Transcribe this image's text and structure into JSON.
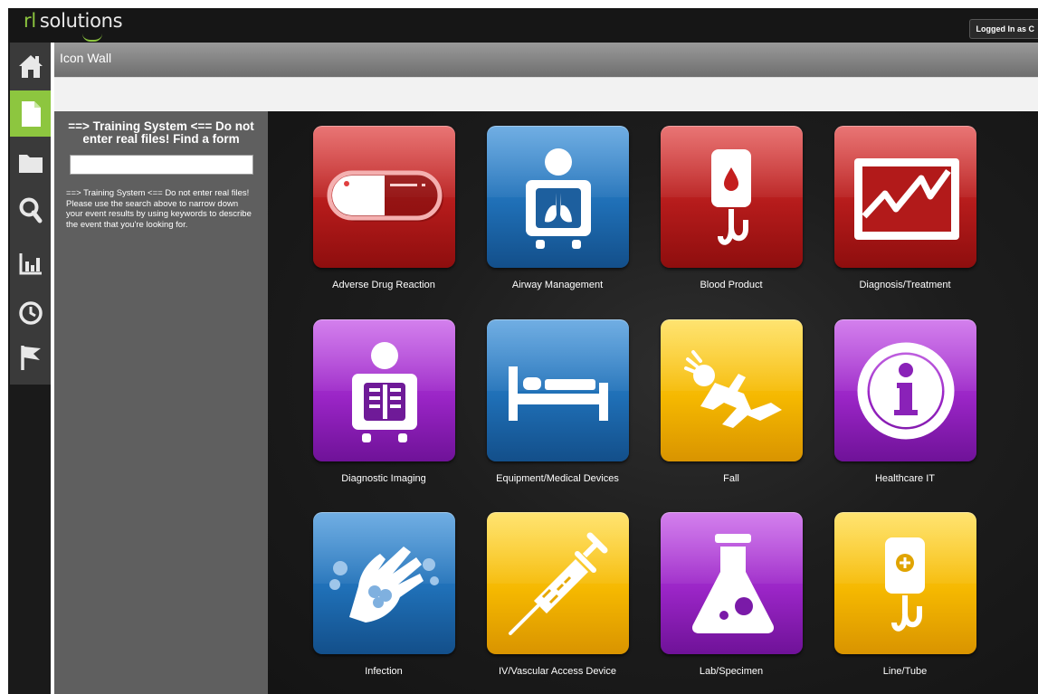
{
  "brand": {
    "prefix": "rl",
    "name": "solutions",
    "accent": "#8dc63f"
  },
  "header": {
    "logged_in": "Logged In as C"
  },
  "nav": {
    "items": [
      {
        "icon": "home-icon",
        "active": false
      },
      {
        "icon": "document-icon",
        "active": true
      },
      {
        "icon": "folder-icon",
        "active": false
      },
      {
        "icon": "search-icon",
        "active": false
      },
      {
        "icon": "bar-chart-icon",
        "active": false
      },
      {
        "icon": "clock-icon",
        "active": false
      },
      {
        "icon": "flag-icon",
        "active": false
      }
    ]
  },
  "page": {
    "title": "Icon Wall"
  },
  "sidebar": {
    "heading": "==> Training System <== Do not enter real files! Find a form",
    "search_value": "",
    "help_text": "==> Training System <== Do not enter real files! Please use the search above to narrow down your event results by using keywords to describe the event that you're looking for."
  },
  "tiles": [
    {
      "label": "Adverse Drug Reaction",
      "color": "red",
      "icon": "pill-icon"
    },
    {
      "label": "Airway Management",
      "color": "blue",
      "icon": "lungs-xray-icon"
    },
    {
      "label": "Blood Product",
      "color": "red",
      "icon": "blood-bag-icon"
    },
    {
      "label": "Diagnosis/Treatment",
      "color": "red",
      "icon": "vital-monitor-icon"
    },
    {
      "label": "Diagnostic Imaging",
      "color": "purple",
      "icon": "xray-icon"
    },
    {
      "label": "Equipment/Medical Devices",
      "color": "blue",
      "icon": "bed-icon"
    },
    {
      "label": "Fall",
      "color": "yellow",
      "icon": "falling-person-icon"
    },
    {
      "label": "Healthcare IT",
      "color": "purple",
      "icon": "info-icon"
    },
    {
      "label": "Infection",
      "color": "blue",
      "icon": "handwashing-icon"
    },
    {
      "label": "IV/Vascular Access Device",
      "color": "yellow",
      "icon": "syringe-icon"
    },
    {
      "label": "Lab/Specimen",
      "color": "purple",
      "icon": "flask-icon"
    },
    {
      "label": "Line/Tube",
      "color": "yellow",
      "icon": "iv-bag-icon"
    }
  ]
}
